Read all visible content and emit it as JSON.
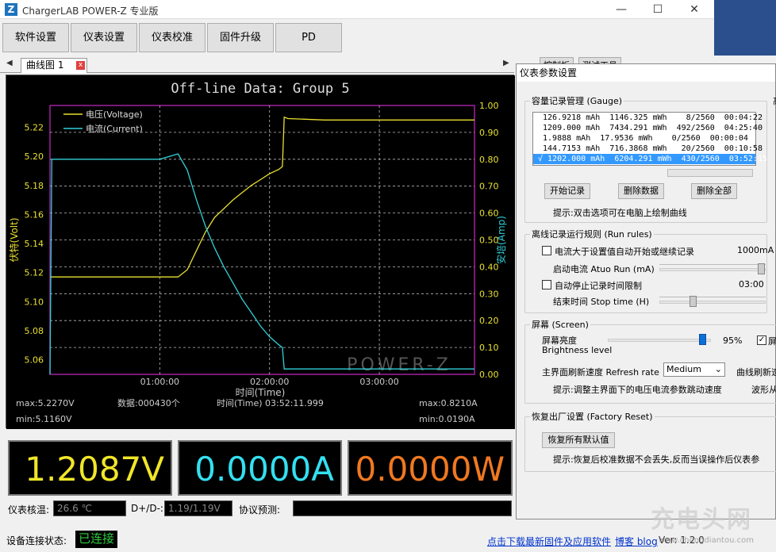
{
  "window": {
    "title": "ChargerLAB POWER-Z 专业版",
    "app_icon": "Z",
    "minimize": "—",
    "maximize": "☐",
    "close": "✕"
  },
  "toolbar": {
    "buttons": [
      "软件设置",
      "仪表设置",
      "仪表校准",
      "固件升级",
      "PD"
    ]
  },
  "tabs": {
    "active": "曲线图 1",
    "close_glyph": "x",
    "left_arrow": "◀",
    "right_arrow": "▶"
  },
  "right_tabs": [
    "控制板",
    "测试工具"
  ],
  "chart_data": {
    "type": "line",
    "title": "Off-line Data: Group 5",
    "ylabel_left": "伏特(Volt)",
    "ylabel_right": "安培(Amp)",
    "xlabel": "时间(Time)",
    "x_ticks": [
      "01:00:00",
      "02:00:00",
      "03:00:00"
    ],
    "y_left_ticks": [
      "5.22",
      "5.20",
      "5.18",
      "5.16",
      "5.14",
      "5.12",
      "5.10",
      "5.08",
      "5.06"
    ],
    "y_right_ticks": [
      "1.00",
      "0.90",
      "0.80",
      "0.70",
      "0.60",
      "0.50",
      "0.40",
      "0.30",
      "0.20",
      "0.10",
      "0.00"
    ],
    "ylim_left": [
      5.05,
      5.235
    ],
    "ylim_right": [
      0.0,
      1.0
    ],
    "xlim_minutes": [
      0,
      232
    ],
    "legend": [
      "电压(Voltage)",
      "电流(Current)"
    ],
    "series": [
      {
        "name": "电压(Voltage)",
        "color": "#e8e030",
        "axis": "left",
        "x": [
          0,
          20,
          40,
          60,
          70,
          75,
          80,
          85,
          90,
          95,
          100,
          105,
          110,
          115,
          120,
          125,
          127,
          128,
          130,
          150,
          180,
          210,
          232
        ],
        "y": [
          5.117,
          5.117,
          5.117,
          5.117,
          5.117,
          5.122,
          5.135,
          5.148,
          5.158,
          5.164,
          5.17,
          5.175,
          5.18,
          5.184,
          5.188,
          5.191,
          5.193,
          5.227,
          5.226,
          5.225,
          5.225,
          5.225,
          5.225
        ]
      },
      {
        "name": "电流(Current)",
        "color": "#30d0d8",
        "axis": "right",
        "x": [
          0,
          1,
          20,
          40,
          60,
          70,
          75,
          80,
          85,
          90,
          95,
          100,
          105,
          110,
          115,
          120,
          125,
          127,
          128,
          130,
          150,
          180,
          210,
          232
        ],
        "y": [
          0.0,
          0.8,
          0.8,
          0.8,
          0.8,
          0.82,
          0.76,
          0.65,
          0.55,
          0.47,
          0.4,
          0.34,
          0.28,
          0.23,
          0.18,
          0.14,
          0.11,
          0.1,
          0.02,
          0.02,
          0.02,
          0.02,
          0.02,
          0.02
        ]
      }
    ],
    "stats": {
      "vmax": "max:5.2270V",
      "vmin": "min:5.1160V",
      "count": "数据:000430个",
      "time": "时间(Time) 03:52:11.999",
      "imax": "max:0.8210A",
      "imin": "min:0.0190A"
    },
    "watermark": "POWER-Z",
    "grid": true
  },
  "meters": {
    "voltage": "1.2087V",
    "current": "0.0000A",
    "power": "0.0000W",
    "voltage_color": "#f0e628",
    "current_color": "#33e0f0",
    "power_color": "#f07820"
  },
  "bottom": {
    "temp_label": "仪表核温:",
    "temp_value": "26.6 ℃",
    "dpdm_label": "D+/D-:",
    "dpdm_value": "1.19/1.19V",
    "protocol_label": "协议预测:",
    "protocol_value": ""
  },
  "status": {
    "label": "设备连接状态:",
    "connected": "已连接",
    "link_download": "点击下载最新固件及应用软件",
    "link_blog": "博客 blog",
    "version": "Ver: 1.2.0"
  },
  "dialog": {
    "title": "仪表参数设置",
    "gauge": {
      "legend": "容量记录管理 (Gauge)",
      "records": [
        " 126.9218 mAh  1146.325 mWh    8/2560  00:04:22",
        " 1209.000 mAh  7434.291 mWh  492/2560  04:25:40",
        " 1.9888 mAh  17.9536 mWh    0/2560  00:00:04",
        " 144.7153 mAh  716.3868 mWh   20/2560  00:10:58",
        "√ 1202.000 mAh  6204.291 mWh  430/2560  03:52:15"
      ],
      "btn_start": "开始记录",
      "btn_delete": "删除数据",
      "btn_delete_all": "删除全部",
      "hint": "提示:双击选项可在电脑上绘制曲线"
    },
    "run_rules": {
      "legend": "离线记录运行规则 (Run rules)",
      "auto_start": "电流大于设置值自动开始或继续记录",
      "auto_start_value": "1000mA",
      "auto_run_label": "启动电流 Atuo Run (mA)",
      "auto_stop": "自动停止记录时间限制",
      "auto_stop_value": "03:00",
      "stop_time_label": "结束时间 Stop time (H)"
    },
    "screen": {
      "legend": "屏幕 (Screen)",
      "brightness_label": "屏幕亮度",
      "brightness_en": "Brightness level",
      "brightness_value": "95%",
      "brightness_level": 0.95,
      "cb_extra": "屏",
      "refresh_label": "主界面刷新速度 Refresh rate",
      "refresh_value": "Medium",
      "curve_refresh": "曲线刷新速",
      "hint": "提示:调整主界面下的电压电流参数跳动速度",
      "hint_tail": "波形从"
    },
    "factory": {
      "legend": "恢复出厂设置 (Factory Reset)",
      "btn": "恢复所有默认值",
      "hint": "提示:恢复后校准数据不会丢失,反而当误操作后仪表参"
    },
    "side_label": "高"
  },
  "watermark": {
    "brand": "充电头网",
    "url": "www.chongdiantou.com"
  }
}
